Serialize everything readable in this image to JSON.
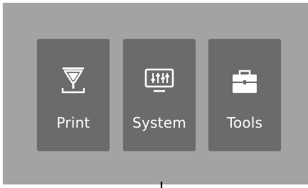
{
  "menu": {
    "tiles": [
      {
        "label": "Print",
        "icon": "printer-nozzle-icon"
      },
      {
        "label": "System",
        "icon": "monitor-sliders-icon"
      },
      {
        "label": "Tools",
        "icon": "toolbox-icon"
      }
    ]
  },
  "colors": {
    "background": "#a3a3a3",
    "tile": "#6b6b6b",
    "icon": "#ffffff",
    "label": "#ffffff"
  }
}
